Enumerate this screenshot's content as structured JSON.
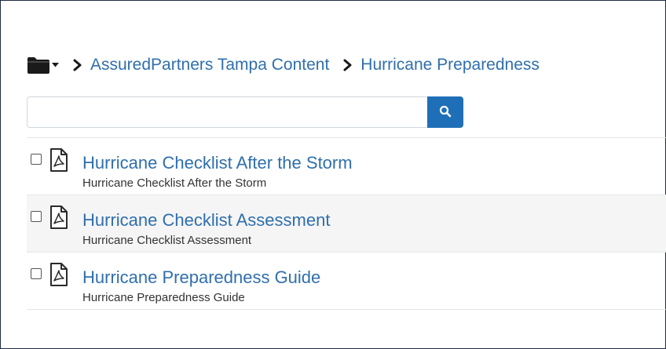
{
  "breadcrumb": {
    "items": [
      {
        "label": "AssuredPartners Tampa Content"
      },
      {
        "label": "Hurricane Preparedness"
      }
    ]
  },
  "search": {
    "value": "",
    "placeholder": ""
  },
  "documents": [
    {
      "title": "Hurricane Checklist After the Storm",
      "description": "Hurricane Checklist After the Storm",
      "icon": "pdf-icon"
    },
    {
      "title": "Hurricane Checklist Assessment",
      "description": "Hurricane Checklist Assessment",
      "icon": "pdf-icon"
    },
    {
      "title": "Hurricane Preparedness Guide",
      "description": "Hurricane Preparedness Guide",
      "icon": "pdf-icon"
    }
  ],
  "colors": {
    "link": "#2f6fad",
    "search_button": "#1e6fb8",
    "frame_border": "#1f2a44"
  },
  "icons": {
    "folder": "folder-icon",
    "dropdown": "caret-down-icon",
    "separator": "chevron-right-icon",
    "search": "search-icon",
    "document": "pdf-icon"
  }
}
